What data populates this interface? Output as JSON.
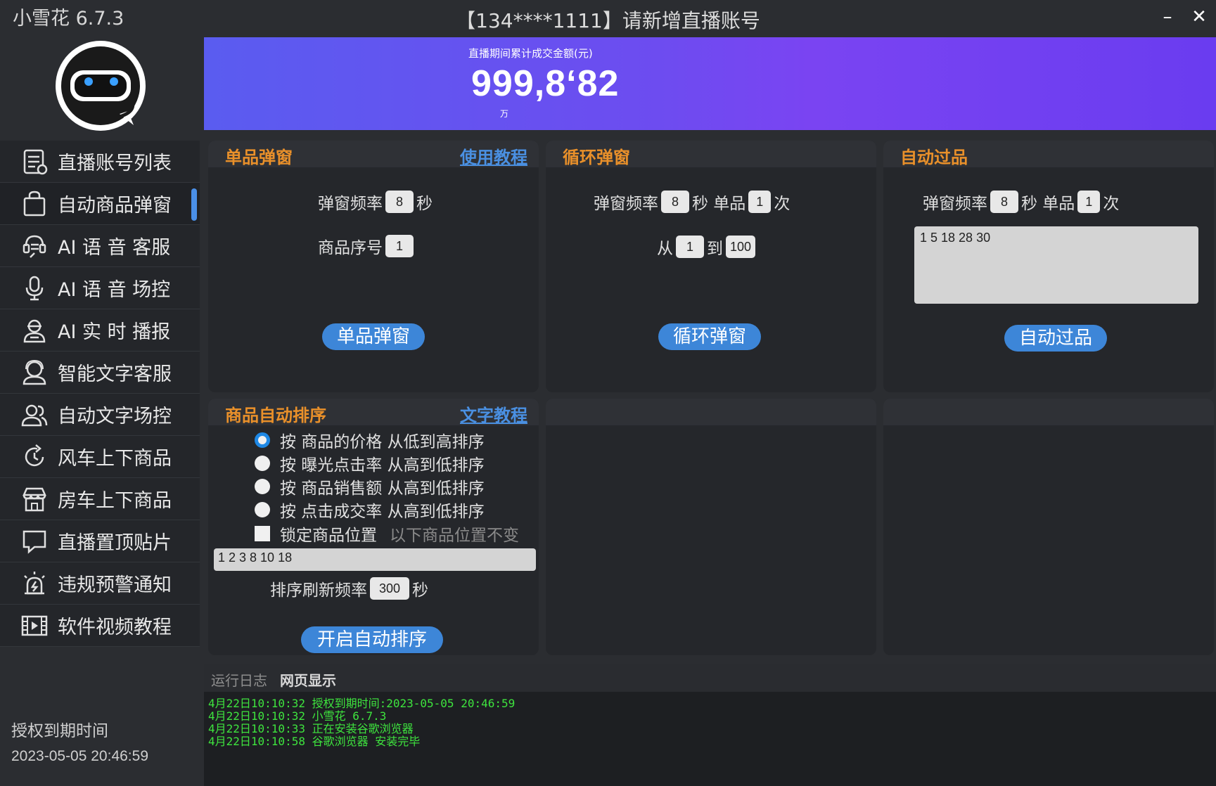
{
  "app_title": "小雪花 6.7.3",
  "window_title": "【134****1111】请新增直播账号",
  "window_controls": {
    "minimize": "–",
    "close": "✕"
  },
  "banner": {
    "caption": "直播期间累计成交金额(元)",
    "value": "999,8‘82",
    "unit": "万"
  },
  "sidebar": {
    "items": [
      {
        "label": "直播账号列表",
        "icon": "list-icon"
      },
      {
        "label": "自动商品弹窗",
        "icon": "shopping-bag-icon",
        "active": true
      },
      {
        "label": "AI 语 音 客服",
        "icon": "voice-service-icon"
      },
      {
        "label": "AI 语 音 场控",
        "icon": "microphone-icon"
      },
      {
        "label": "AI 实 时 播报",
        "icon": "anchor-icon"
      },
      {
        "label": "智能文字客服",
        "icon": "customer-service-icon"
      },
      {
        "label": "自动文字场控",
        "icon": "users-icon"
      },
      {
        "label": "风车上下商品",
        "icon": "refresh-icon"
      },
      {
        "label": "房车上下商品",
        "icon": "store-icon"
      },
      {
        "label": "直播置顶贴片",
        "icon": "comment-icon"
      },
      {
        "label": "违规预警通知",
        "icon": "alarm-icon"
      },
      {
        "label": "软件视频教程",
        "icon": "video-icon"
      }
    ],
    "license_label": "授权到期时间",
    "license_value": "2023-05-05 20:46:59"
  },
  "single_popup": {
    "title": "单品弹窗",
    "tutorial_link": "使用教程",
    "freq_label": "弹窗频率",
    "freq_value": "8",
    "sec": "秒",
    "index_label": "商品序号",
    "index_value": "1",
    "button": "单品弹窗"
  },
  "loop_popup": {
    "title": "循环弹窗",
    "freq_label": "弹窗频率",
    "freq_value": "8",
    "sec_single": "秒 单品",
    "count_value": "1",
    "times": "次",
    "from_label": "从",
    "from_value": "1",
    "to_label": "到",
    "to_value": "100",
    "button": "循环弹窗"
  },
  "auto_pass": {
    "title": "自动过品",
    "freq_label": "弹窗频率",
    "freq_value": "8",
    "sec_single": "秒 单品",
    "count_value": "1",
    "times": "次",
    "list_value": "1 5 18 28 30",
    "button": "自动过品"
  },
  "auto_sort": {
    "title": "商品自动排序",
    "tutorial_link": "文字教程",
    "options": [
      {
        "label": "按 商品的价格 从低到高排序",
        "checked": true
      },
      {
        "label": "按 曝光点击率 从高到低排序",
        "checked": false
      },
      {
        "label": "按 商品销售额 从高到低排序",
        "checked": false
      },
      {
        "label": "按 点击成交率 从高到低排序",
        "checked": false
      }
    ],
    "lock_label": "锁定商品位置",
    "lock_hint": "以下商品位置不变",
    "lock_value": "1 2 3 8 10 18",
    "refresh_label": "排序刷新频率",
    "refresh_value": "300",
    "sec": "秒",
    "button": "开启自动排序"
  },
  "log": {
    "tab_run": "运行日志",
    "tab_web": "网页显示",
    "lines": [
      "4月22日10:10:32 授权到期时间:2023-05-05 20:46:59",
      "4月22日10:10:32 小雪花 6.7.3",
      "4月22日10:10:33 正在安装谷歌浏览器",
      "4月22日10:10:58 谷歌浏览器 安装完毕"
    ]
  },
  "colors": {
    "accent": "#3d86d8",
    "panel_title": "#e9902a",
    "log_text": "#3ee43e",
    "banner_start": "#5a5cf0",
    "banner_end": "#6a3cf0"
  }
}
